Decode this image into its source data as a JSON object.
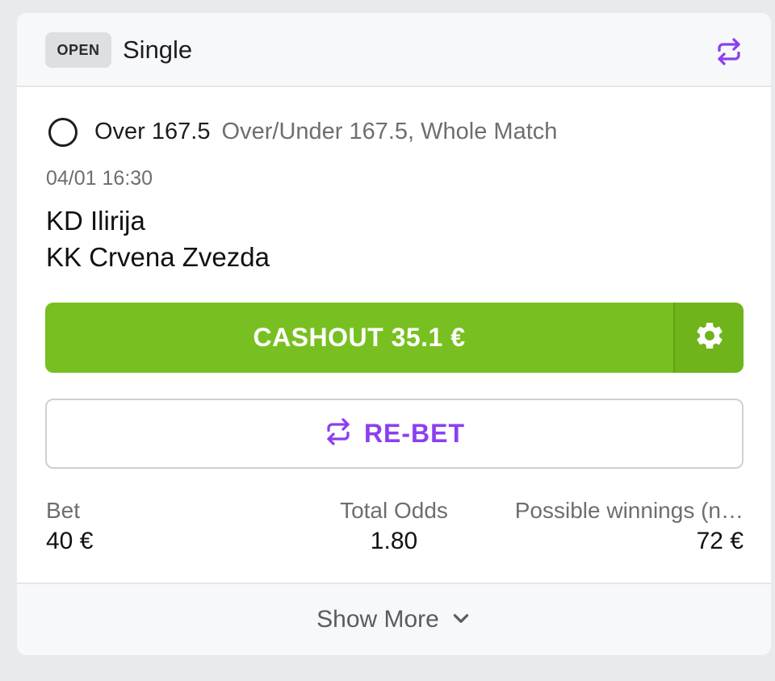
{
  "bet": {
    "status": "OPEN",
    "type": "Single"
  },
  "selection": {
    "name": "Over 167.5",
    "market": "Over/Under 167.5, Whole Match"
  },
  "event": {
    "datetime": "04/01 16:30",
    "home_team": "KD Ilirija",
    "away_team": "KK Crvena Zvezda"
  },
  "actions": {
    "cashout_label": "CASHOUT 35.1 €",
    "rebet_label": "RE-BET"
  },
  "stats": {
    "bet_label": "Bet",
    "bet_value": "40 €",
    "odds_label": "Total Odds",
    "odds_value": "1.80",
    "winnings_label": "Possible winnings (n…",
    "winnings_value": "72 €"
  },
  "footer": {
    "show_more_label": "Show More"
  },
  "colors": {
    "accent_purple": "#8b3ff0",
    "cashout_green": "#78c021"
  },
  "icons": {
    "rebet": "rebet-arrows-icon",
    "settings": "gear-icon",
    "chevron": "chevron-down-icon",
    "radio": "radio-unchecked-icon"
  }
}
